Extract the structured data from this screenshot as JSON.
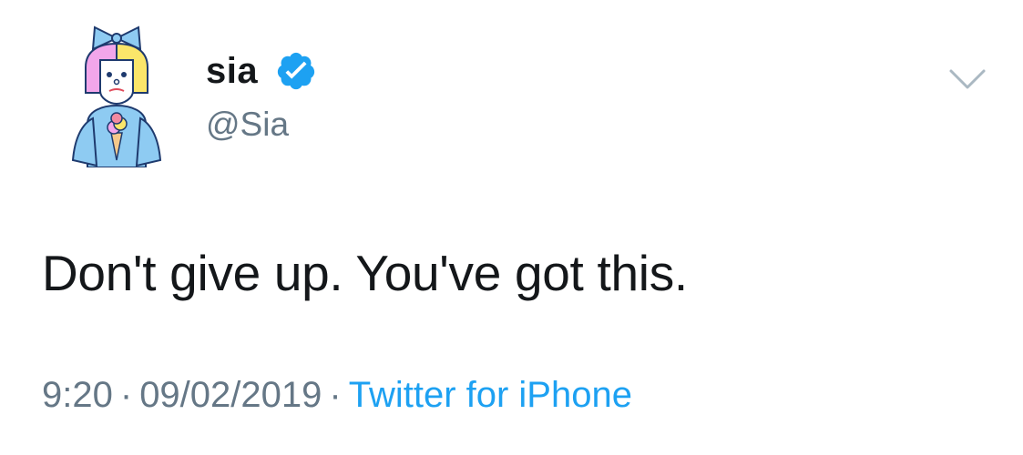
{
  "tweet": {
    "author": {
      "display_name": "sia",
      "handle": "@Sia",
      "verified": true,
      "verified_icon": "verified-badge-icon",
      "avatar": "sia-cartoon-avatar"
    },
    "menu_icon": "chevron-down-icon",
    "text": "Don't give up. You've got this.",
    "meta": {
      "time": "9:20",
      "separator": "·",
      "date": "09/02/2019",
      "source": "Twitter for iPhone"
    }
  },
  "colors": {
    "text_primary": "#14171a",
    "text_secondary": "#657786",
    "link": "#1da1f2",
    "verified": "#1da1f2"
  }
}
